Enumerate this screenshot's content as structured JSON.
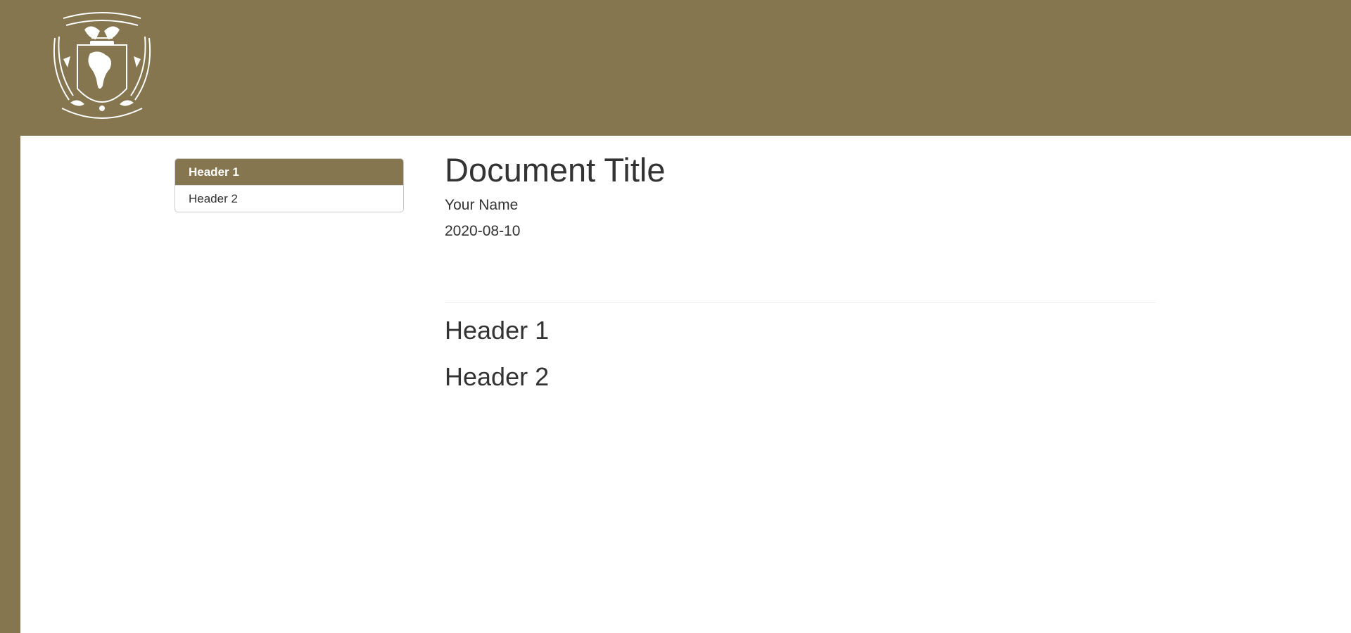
{
  "colors": {
    "brand": "#857650",
    "text": "#333333",
    "background": "#ffffff"
  },
  "header": {
    "logo_icon": "unam-crest-icon"
  },
  "toc": {
    "items": [
      {
        "label": "Header 1",
        "active": true
      },
      {
        "label": "Header 2",
        "active": false
      }
    ]
  },
  "document": {
    "title": "Document Title",
    "author": "Your Name",
    "date": "2020-08-10",
    "sections": [
      "Header 1",
      "Header 2"
    ]
  }
}
